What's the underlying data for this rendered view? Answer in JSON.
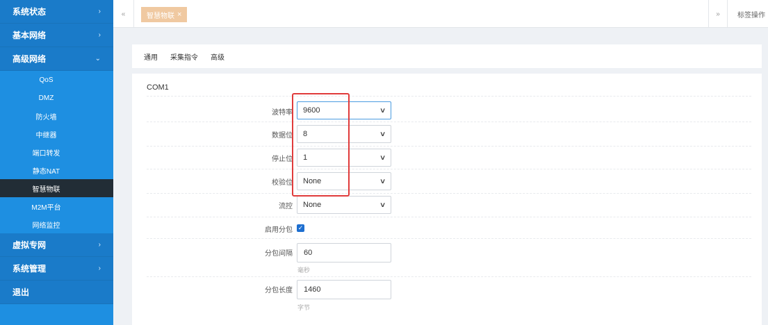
{
  "sidebar": {
    "items": [
      {
        "label": "系统状态",
        "chevron": "›"
      },
      {
        "label": "基本网络",
        "chevron": "›"
      },
      {
        "label": "高级网络",
        "chevron": "⌄"
      }
    ],
    "sub_items": [
      {
        "label": "QoS"
      },
      {
        "label": "DMZ"
      },
      {
        "label": "防火墙"
      },
      {
        "label": "中继器"
      },
      {
        "label": "端口转发"
      },
      {
        "label": "静态NAT"
      },
      {
        "label": "智慧物联"
      },
      {
        "label": "M2M平台"
      },
      {
        "label": "网络监控"
      }
    ],
    "bottom_items": [
      {
        "label": "虚拟专网",
        "chevron": "›"
      },
      {
        "label": "系统管理",
        "chevron": "›"
      },
      {
        "label": "退出",
        "chevron": ""
      }
    ]
  },
  "tabbar": {
    "prev_icon": "«",
    "active_tab": "智慧物联",
    "close_icon": "×",
    "next_icon": "»",
    "ops_label": "标签操作"
  },
  "subtabs": [
    "通用",
    "采集指令",
    "高级"
  ],
  "form": {
    "section_title": "COM1",
    "baud": {
      "label": "波特率",
      "value": "9600"
    },
    "databits": {
      "label": "数据位",
      "value": "8"
    },
    "stopbits": {
      "label": "停止位",
      "value": "1"
    },
    "parity": {
      "label": "校验位",
      "value": "None"
    },
    "flow": {
      "label": "流控",
      "value": "None"
    },
    "packet": {
      "label": "启用分包",
      "checked": true,
      "check_glyph": "✓"
    },
    "interval": {
      "label": "分包间隔",
      "value": "60",
      "unit": "毫秒"
    },
    "length": {
      "label": "分包长度",
      "value": "1460",
      "unit": "字节"
    }
  },
  "colors": {
    "sidebar_bg": "#1e8fe1",
    "sidebar_active": "#222d36",
    "tab_active": "#f0c9a1",
    "highlight": "#e03b3b",
    "checkbox": "#1e6fd0"
  }
}
